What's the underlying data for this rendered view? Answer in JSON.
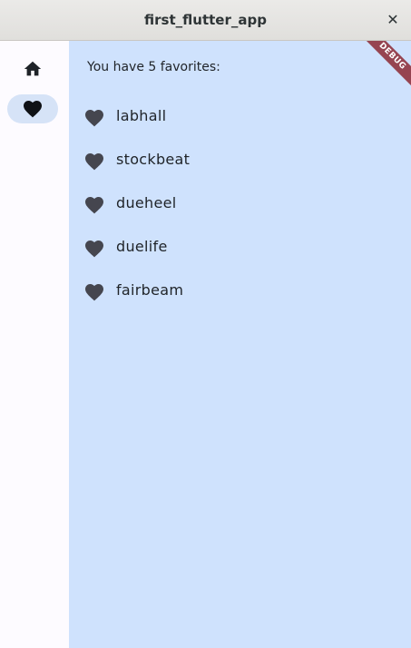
{
  "window": {
    "title": "first_flutter_app",
    "close_glyph": "✕"
  },
  "rail": {
    "items": [
      {
        "name": "home",
        "icon": "home-icon",
        "selected": false
      },
      {
        "name": "favorites",
        "icon": "heart-icon",
        "selected": true
      }
    ]
  },
  "favorites": {
    "count_text": "You have 5 favorites:",
    "items": [
      {
        "label": "labhall"
      },
      {
        "label": "stockbeat"
      },
      {
        "label": "dueheel"
      },
      {
        "label": "duelife"
      },
      {
        "label": "fairbeam"
      }
    ]
  },
  "debug_banner": "DEBUG",
  "colors": {
    "content_bg": "#cfe2fd",
    "rail_bg": "#fdfbff",
    "selected_indicator": "#d6e3f7",
    "icon": "#45464f",
    "debug_ribbon": "#8c2832"
  }
}
